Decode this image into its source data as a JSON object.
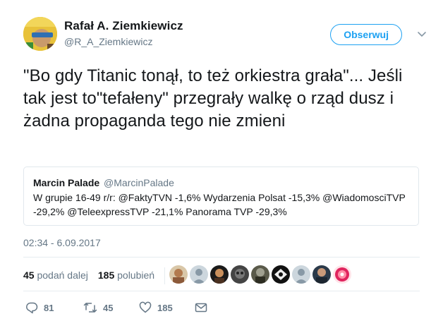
{
  "author": {
    "display_name": "Rafał A. Ziemkiewicz",
    "screen_name": "@R_A_Ziemkiewicz",
    "avatar_icon": "user-avatar"
  },
  "follow_button": {
    "label": "Obserwuj"
  },
  "caret_icon": "chevron-down-icon",
  "tweet": {
    "text": "\"Bo gdy Titanic tonął, to też orkiestra grała\"... Jeśli tak jest to\"tefałeny\" przegrały walkę o rząd dusz i żadna propaganda tego nie zmieni"
  },
  "quote": {
    "name": "Marcin Palade",
    "screen_name": "@MarcinPalade",
    "text": "W grupie 16-49 r/r: @FaktyTVN -1,6% Wydarzenia Polsat -15,3% @WiadomosciTVP -29,2% @TeleexpressTVP -21,1% Panorama TVP -29,3%"
  },
  "timestamp": "02:34 - 6.09.2017",
  "stats": {
    "retweets_count": "45",
    "retweets_label": "podań dalej",
    "likes_count": "185",
    "likes_label": "polubień"
  },
  "likers": [
    {
      "icon": "liker-avatar-1"
    },
    {
      "icon": "liker-avatar-2"
    },
    {
      "icon": "liker-avatar-3"
    },
    {
      "icon": "liker-avatar-4"
    },
    {
      "icon": "liker-avatar-5"
    },
    {
      "icon": "liker-avatar-6"
    },
    {
      "icon": "liker-avatar-7"
    },
    {
      "icon": "liker-avatar-8"
    },
    {
      "icon": "liker-avatar-9"
    }
  ],
  "actions": {
    "reply_count": "81",
    "retweet_count": "45",
    "like_count": "185"
  },
  "colors": {
    "accent": "#1da1f2",
    "text": "#14171a",
    "muted": "#657786",
    "border": "#e1e8ed"
  }
}
